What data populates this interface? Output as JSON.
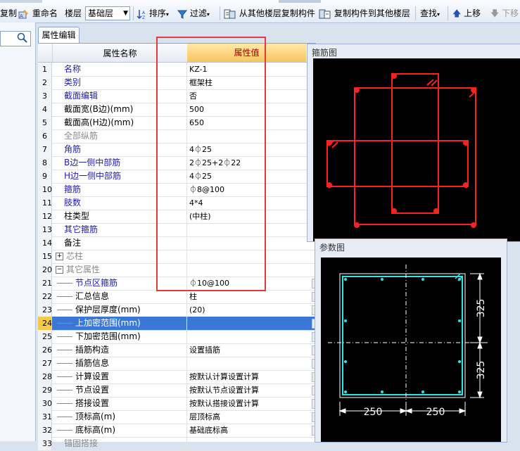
{
  "toolbar": {
    "copy_label": "复制",
    "rename_label": "重命名",
    "floor_label": "楼层",
    "floor_value": "基础层",
    "sort_label": "排序",
    "filter_label": "过滤",
    "copy_from_label": "从其他楼层复制构件",
    "copy_to_label": "复制构件到其他楼层",
    "find_label": "查找",
    "move_up_label": "上移",
    "move_down_label": "下移"
  },
  "tab": {
    "label": "属性编辑"
  },
  "grid": {
    "header_name": "属性名称",
    "header_value": "属性值",
    "rows": [
      {
        "num": "1",
        "name": "名称",
        "value": "KZ-1"
      },
      {
        "num": "2",
        "name": "类别",
        "value": "框架柱"
      },
      {
        "num": "3",
        "name": "截面编辑",
        "value": "否"
      },
      {
        "num": "4",
        "name": "截面宽(B边)(mm)",
        "value": "500"
      },
      {
        "num": "5",
        "name": "截面高(H边)(mm)",
        "value": "650"
      },
      {
        "num": "6",
        "name": "全部纵筋",
        "value": ""
      },
      {
        "num": "7",
        "name": "角筋",
        "value": "4⏀25"
      },
      {
        "num": "8",
        "name": "B边一侧中部筋",
        "value": "2⏀25+2⏀22"
      },
      {
        "num": "9",
        "name": "H边一侧中部筋",
        "value": "4⏀25"
      },
      {
        "num": "10",
        "name": "箍筋",
        "value": "⏀8@100"
      },
      {
        "num": "11",
        "name": "肢数",
        "value": "4*4"
      },
      {
        "num": "12",
        "name": "柱类型",
        "value": "(中柱)"
      },
      {
        "num": "13",
        "name": "其它箍筋",
        "value": ""
      },
      {
        "num": "14",
        "name": "备注",
        "value": ""
      },
      {
        "num": "15",
        "name": "芯柱",
        "value": ""
      },
      {
        "num": "20",
        "name": "其它属性",
        "value": ""
      },
      {
        "num": "21",
        "name": "节点区箍筋",
        "value": "⏀10@100"
      },
      {
        "num": "22",
        "name": "汇总信息",
        "value": "柱"
      },
      {
        "num": "23",
        "name": "保护层厚度(mm)",
        "value": "(20)"
      },
      {
        "num": "24",
        "name": "上加密范围(mm)",
        "value": ""
      },
      {
        "num": "25",
        "name": "下加密范围(mm)",
        "value": ""
      },
      {
        "num": "26",
        "name": "插筋构造",
        "value": "设置插筋"
      },
      {
        "num": "27",
        "name": "插筋信息",
        "value": ""
      },
      {
        "num": "28",
        "name": "计算设置",
        "value": "按默认计算设置计算"
      },
      {
        "num": "29",
        "name": "节点设置",
        "value": "按默认节点设置计算"
      },
      {
        "num": "30",
        "name": "搭接设置",
        "value": "按默认搭接设置计算"
      },
      {
        "num": "31",
        "name": "顶标高(m)",
        "value": "层顶标高"
      },
      {
        "num": "32",
        "name": "底标高(m)",
        "value": "基础底标高"
      },
      {
        "num": "33",
        "name": "锚固搭接",
        "value": ""
      }
    ]
  },
  "stirrup_panel": {
    "title": "箍筋图"
  },
  "param_panel": {
    "title": "参数图",
    "dim_top": "325",
    "dim_bottom": "325",
    "dim_left": "250",
    "dim_right": "250"
  },
  "colors": {
    "red_box": "#e53a3a",
    "selection": "#3b78d6",
    "stirrup": "#ff2020",
    "param_lines": "#2ee6e6"
  }
}
